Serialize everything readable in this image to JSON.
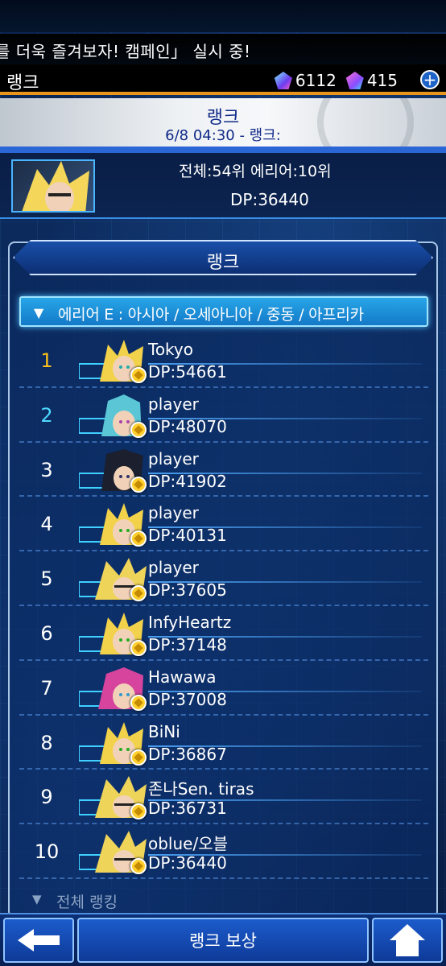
{
  "ticker_text": "를 더욱 즐겨보자! 캠페인」 실시 중!",
  "title": "랭크",
  "currency": {
    "gems": "6112",
    "tickets": "415",
    "add_symbol": "+"
  },
  "banner": {
    "title": "랭크",
    "subtitle": "6/8 04:30 - 랭크:"
  },
  "me": {
    "ranking_text": "전체:54위   에리어:10위",
    "dp": "DP:36440"
  },
  "panel": {
    "header": "랭크",
    "region": "에리어 E : 아시아 / 오세아니아 / 중동 / 아프리카",
    "region_marker": "▼",
    "all_ranking": "전체 랭킹",
    "all_ranking_marker": "▼"
  },
  "rows": [
    {
      "rank": "1",
      "name": "Tokyo",
      "dp": "DP:54661"
    },
    {
      "rank": "2",
      "name": "player",
      "dp": "DP:48070"
    },
    {
      "rank": "3",
      "name": "player",
      "dp": "DP:41902"
    },
    {
      "rank": "4",
      "name": "player",
      "dp": "DP:40131"
    },
    {
      "rank": "5",
      "name": "player",
      "dp": "DP:37605"
    },
    {
      "rank": "6",
      "name": "InfyHeartz",
      "dp": "DP:37148"
    },
    {
      "rank": "7",
      "name": "Hawawa",
      "dp": "DP:37008"
    },
    {
      "rank": "8",
      "name": "BiNi",
      "dp": "DP:36867"
    },
    {
      "rank": "9",
      "name": "존나Sen. tiras",
      "dp": "DP:36731"
    },
    {
      "rank": "10",
      "name": "oblue/오블",
      "dp": "DP:36440"
    }
  ],
  "bottom": {
    "reward_label": "랭크 보상"
  },
  "colors": {
    "accent_orange": "#e9951c",
    "rank1": "#ffc21a",
    "rank2": "#4fd9ff",
    "primary_blue": "#1c5bcc"
  },
  "icons": [
    "gem-icon",
    "ticket-icon",
    "plus-icon",
    "back-arrow-icon",
    "home-icon",
    "rank-badge-icon"
  ]
}
